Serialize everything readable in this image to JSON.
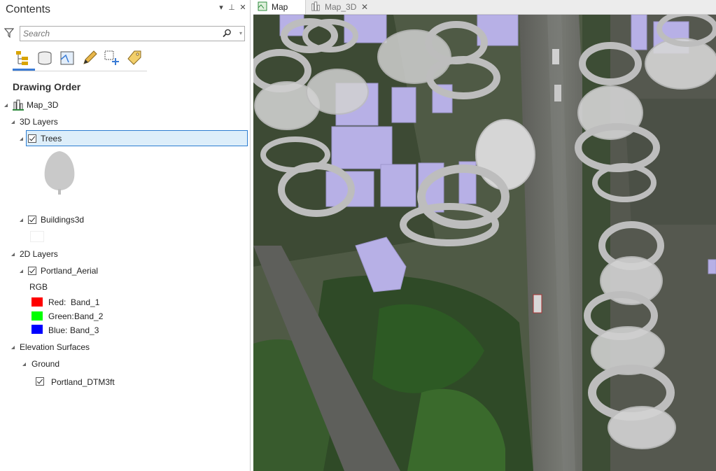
{
  "pane": {
    "title": "Contents",
    "controls": {
      "menu": "▾",
      "pin": "⊥",
      "close": "✕"
    },
    "search": {
      "placeholder": "Search"
    },
    "views": [
      "list-by-drawing-order-icon",
      "list-by-data-source-icon",
      "list-by-selection-icon",
      "list-by-editing-icon",
      "list-by-snapping-icon",
      "list-by-labeling-icon"
    ],
    "heading": "Drawing Order",
    "tree": {
      "map": "Map_3D",
      "layers3d": "3D Layers",
      "trees": "Trees",
      "buildings": "Buildings3d",
      "layers2d": "2D Layers",
      "aerial": "Portland_Aerial",
      "rgb": "RGB",
      "bands": [
        {
          "name": "Red:",
          "band": "Band_1",
          "color": "#ff0000"
        },
        {
          "name": "Green:",
          "band": "Band_2",
          "color": "#00ff00"
        },
        {
          "name": "Blue:",
          "band": "Band_3",
          "color": "#0000ff"
        }
      ],
      "elevation": "Elevation Surfaces",
      "ground": "Ground",
      "dtm": "Portland_DTM3ft"
    }
  },
  "tabs": [
    {
      "label": "Map",
      "active": true
    },
    {
      "label": "Map_3D",
      "active": false,
      "close": "✕"
    }
  ],
  "colors": {
    "accent": "#2c7cd1",
    "selection": "#ddeefa",
    "building": "#b7b0e6",
    "tree": "#d2d2d2"
  }
}
